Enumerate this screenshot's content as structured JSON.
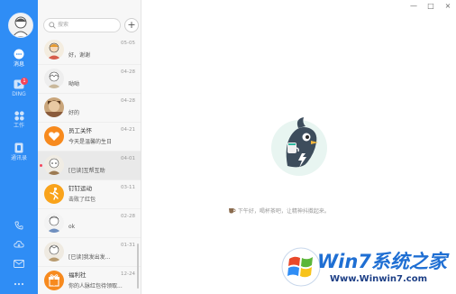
{
  "sidebar": {
    "nav": [
      {
        "label": "消息",
        "icon": "chat-icon",
        "active": true
      },
      {
        "label": "DING",
        "icon": "ding-icon",
        "badge": "1"
      },
      {
        "label": "工作",
        "icon": "apps-grid-icon"
      },
      {
        "label": "通讯录",
        "icon": "contacts-icon"
      }
    ],
    "bottom": [
      "phone-icon",
      "cloud-icon",
      "mail-icon",
      "more-icon"
    ]
  },
  "list": {
    "search_placeholder": "搜索",
    "add_label": "+",
    "items": [
      {
        "title": "",
        "preview": "好，谢谢",
        "time": "05-05"
      },
      {
        "title": "",
        "preview": "呦呦",
        "time": "04-28"
      },
      {
        "title": "",
        "preview": "好的",
        "time": "04-28"
      },
      {
        "title": "员工关怀",
        "preview": "今天是温馨的生日",
        "time": "04-21"
      },
      {
        "title": "",
        "preview": "[已读]互帮互助",
        "time": "04-01"
      },
      {
        "title": "钉钉运动",
        "preview": "击败了红包",
        "time": "03-11"
      },
      {
        "title": "",
        "preview": "ok",
        "time": "02-28"
      },
      {
        "title": "",
        "preview": "[已读]我发出发...",
        "time": "01-31"
      },
      {
        "title": "福利社",
        "preview": "你的人脉红包待领取...",
        "time": "12-24"
      }
    ]
  },
  "main": {
    "greeting": "下午好，喝杯茶吧，让精神抖擞起来。",
    "window_controls": [
      "—",
      "□",
      "×"
    ]
  },
  "watermark": {
    "brand": "Win7系统之家",
    "url": "Www.Winwin7.com"
  },
  "colors": {
    "sidebar": "#2f8df5",
    "unread": "#f5455b",
    "mascot_bg": "#e8f5f1"
  }
}
